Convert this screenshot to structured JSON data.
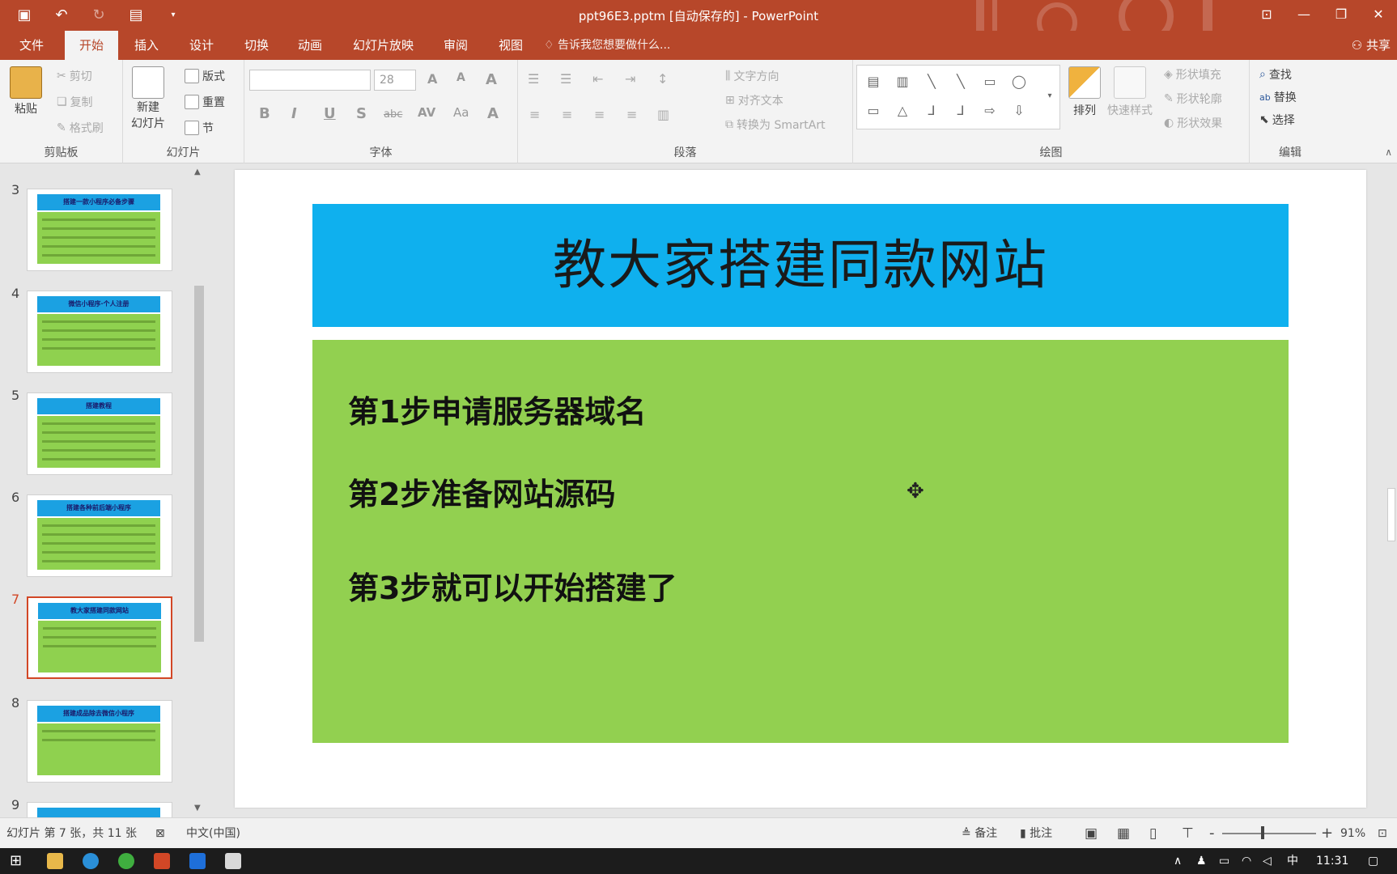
{
  "window": {
    "title": "ppt96E3.pptm [自动保存的] - PowerPoint"
  },
  "tabs": {
    "file": "文件",
    "home": "开始",
    "insert": "插入",
    "design": "设计",
    "transitions": "切换",
    "animations": "动画",
    "slideshow": "幻灯片放映",
    "review": "审阅",
    "view": "视图",
    "tellme": "告诉我您想要做什么...",
    "share": "共享"
  },
  "ribbon": {
    "clipboard": {
      "label": "剪贴板",
      "paste": "粘贴",
      "cut": "剪切",
      "copy": "复制",
      "format_painter": "格式刷"
    },
    "slides": {
      "label": "幻灯片",
      "new_slide": "新建",
      "new_slide2": "幻灯片",
      "layout": "版式",
      "reset": "重置",
      "section": "节"
    },
    "font": {
      "label": "字体",
      "font_name": "",
      "font_size": "28"
    },
    "paragraph": {
      "label": "段落",
      "text_direction": "文字方向",
      "align_text": "对齐文本",
      "smartart": "转换为 SmartArt"
    },
    "drawing": {
      "label": "绘图",
      "arrange": "排列",
      "quick_styles": "快速样式",
      "shape_fill": "形状填充",
      "shape_outline": "形状轮廓",
      "shape_effects": "形状效果"
    },
    "editing": {
      "label": "编辑",
      "find": "查找",
      "replace": "替换",
      "select": "选择"
    }
  },
  "thumbnails": [
    {
      "num": "3",
      "title": "搭建一款小程序必备步骤"
    },
    {
      "num": "4",
      "title": "微信小程序·个人注册"
    },
    {
      "num": "5",
      "title": "搭建教程"
    },
    {
      "num": "6",
      "title": "搭建各种前后端小程序"
    },
    {
      "num": "7",
      "title": "教大家搭建同款网站"
    },
    {
      "num": "8",
      "title": "搭建成品除去微信小程序"
    },
    {
      "num": "9",
      "title": ""
    }
  ],
  "slide": {
    "title": "教大家搭建同款网站",
    "steps": [
      "第1步申请服务器域名",
      "第2步准备网站源码",
      "第3步就可以开始搭建了"
    ]
  },
  "status": {
    "slide_info": "幻灯片 第 7 张，共 11 张",
    "language": "中文(中国)",
    "notes": "备注",
    "comments": "批注",
    "zoom_minus": "-",
    "zoom_plus": "+",
    "zoom": "91%"
  },
  "taskbar": {
    "ime": "中",
    "time": "11:31"
  },
  "colors": {
    "ppt_red": "#b7472a",
    "title_blue": "#0fb0ee",
    "body_green": "#92d050",
    "active_thumb": "#d24726"
  }
}
